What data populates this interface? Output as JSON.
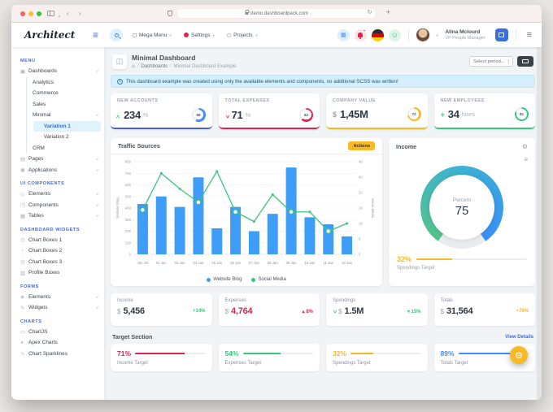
{
  "browser": {
    "url": "demo.dashboardpack.com",
    "new_tab": "+"
  },
  "header": {
    "logo": "Architect",
    "nav": [
      {
        "label": "Mega Menu"
      },
      {
        "label": "Settings"
      },
      {
        "label": "Projects"
      }
    ],
    "user": {
      "name": "Alina Mclourd",
      "role": "VP People Manager"
    }
  },
  "sidebar": {
    "sections": [
      {
        "header": "MENU",
        "items": [
          {
            "label": "Dashboards",
            "icon": "dashboards-icon",
            "chevron": true,
            "children": [
              {
                "label": "Analytics"
              },
              {
                "label": "Commerce"
              },
              {
                "label": "Sales"
              },
              {
                "label": "Minimal",
                "chevron": true,
                "children": [
                  {
                    "label": "Variation 1",
                    "active": true
                  },
                  {
                    "label": "Variation 2"
                  }
                ]
              },
              {
                "label": "CRM"
              }
            ]
          },
          {
            "label": "Pages",
            "icon": "pages-icon",
            "chevron": true
          },
          {
            "label": "Applications",
            "icon": "applications-icon",
            "chevron": true
          }
        ]
      },
      {
        "header": "UI COMPONENTS",
        "items": [
          {
            "label": "Elements",
            "icon": "elements-icon",
            "chevron": true
          },
          {
            "label": "Components",
            "icon": "components-icon",
            "chevron": true
          },
          {
            "label": "Tables",
            "icon": "tables-icon",
            "chevron": true
          }
        ]
      },
      {
        "header": "DASHBOARD WIDGETS",
        "items": [
          {
            "label": "Chart Boxes 1",
            "icon": "chart-box-1-icon"
          },
          {
            "label": "Chart Boxes 2",
            "icon": "chart-box-2-icon"
          },
          {
            "label": "Chart Boxes 3",
            "icon": "chart-box-3-icon"
          },
          {
            "label": "Profile Boxes",
            "icon": "profile-boxes-icon"
          }
        ]
      },
      {
        "header": "FORMS",
        "items": [
          {
            "label": "Elements",
            "icon": "form-elements-icon",
            "chevron": true
          },
          {
            "label": "Widgets",
            "icon": "widgets-icon",
            "chevron": true
          }
        ]
      },
      {
        "header": "CHARTS",
        "items": [
          {
            "label": "ChartJS",
            "icon": "chartjs-icon"
          },
          {
            "label": "Apex Charts",
            "icon": "apex-charts-icon"
          },
          {
            "label": "Chart Sparklines",
            "icon": "sparklines-icon"
          }
        ]
      }
    ],
    "icon_glyphs": {
      "dashboards-icon": "▣",
      "pages-icon": "▤",
      "applications-icon": "◉",
      "elements-icon": "◇",
      "components-icon": "◳",
      "tables-icon": "▦",
      "chart-box-1-icon": "◷",
      "chart-box-2-icon": "◔",
      "chart-box-3-icon": "◎",
      "profile-boxes-icon": "▥",
      "form-elements-icon": "◈",
      "widgets-icon": "✎",
      "chartjs-icon": "▭",
      "apex-charts-icon": "◕",
      "sparklines-icon": "∿"
    }
  },
  "page": {
    "title": "Minimal Dashboard",
    "breadcrumb": [
      "Dashboards",
      "Minimal Dashboard Example"
    ],
    "select_period": "Select period...",
    "alert": "This dashboard example was created using only the available elements and components, no additional SCSS was written!"
  },
  "kpis": [
    {
      "label": "NEW ACCOUNTS",
      "lead": {
        "kind": "chevron-up",
        "color": "#3ac47d"
      },
      "value": "234",
      "unit": "%",
      "gauge": {
        "value": 58,
        "color": "#3f8cfe"
      },
      "border_color": "#4a5ed5"
    },
    {
      "label": "TOTAL EXPENSES",
      "lead": {
        "kind": "chevron-down",
        "color": "#d92550"
      },
      "value": "71",
      "unit": "%",
      "gauge": {
        "value": 62,
        "color": "#d92550"
      },
      "border_color": "#d92550"
    },
    {
      "label": "COMPANY VALUE",
      "lead": {
        "kind": "text",
        "text": "$",
        "color": "#9aa3ad"
      },
      "value": "1,45M",
      "unit": "",
      "gauge": {
        "value": 72,
        "color": "#f7b924"
      },
      "border_color": "#f7b924"
    },
    {
      "label": "NEW EMPLOYEES",
      "lead": {
        "kind": "text",
        "text": "+",
        "color": "#3ac47d"
      },
      "value": "34",
      "unit": "hires",
      "gauge": {
        "value": 81,
        "color": "#3ac47d"
      },
      "border_color": "#3ac47d"
    }
  ],
  "traffic_card": {
    "title": "Traffic Sources",
    "action": "Actions"
  },
  "chart_data": [
    {
      "type": "bar+line",
      "title": "Traffic Sources",
      "categories": [
        "Jan '00",
        "02 Jan",
        "03 Jan",
        "04 Jan",
        "05 Jan",
        "06 Jan",
        "07 Jan",
        "08 Jan",
        "09 Jan",
        "10 Jan",
        "11 Jan",
        "12 Jan"
      ],
      "series": [
        {
          "name": "Website Blog",
          "type": "bar",
          "axis": "left",
          "color": "#3d9df7",
          "values": [
            435,
            500,
            410,
            665,
            225,
            410,
            200,
            350,
            750,
            320,
            260,
            155
          ]
        },
        {
          "name": "Social Media",
          "type": "line",
          "axis": "right",
          "color": "#3ac47d",
          "values": [
            23,
            42,
            34,
            27,
            43,
            22,
            17,
            31,
            22,
            22,
            12,
            16
          ],
          "ring_markers": [
            0,
            3,
            5,
            8,
            10
          ]
        }
      ],
      "left_axis": {
        "label": "Website Blog",
        "min": 0,
        "max": 800,
        "step": 100
      },
      "right_axis": {
        "label": "Social Media",
        "min": 0,
        "max": 48,
        "step": 8
      },
      "grid": true,
      "legend_position": "bottom"
    },
    {
      "type": "gauge",
      "title": "Income",
      "label": "Percent",
      "value": 75,
      "min": 0,
      "max": 100,
      "colors": [
        "#3ac47d",
        "#3a8ff7"
      ],
      "track_color": "#e8ecef"
    }
  ],
  "income_card": {
    "title": "Income",
    "percent_label": "Percent",
    "percent_value": "75",
    "target_pct": "32%",
    "target_pct_value": 32,
    "target_label": "Spendings Target",
    "target_color": "#f7b924"
  },
  "stats": [
    {
      "label": "Income",
      "currency": "$",
      "value": "5,456",
      "value_color": "#2f3944",
      "delta": {
        "text": "+14%",
        "color": "#3ac47d"
      }
    },
    {
      "label": "Expenses",
      "currency": "$",
      "value": "4,764",
      "value_color": "#d92550",
      "delta": {
        "dir": "up",
        "text": "8%",
        "color": "#d92550"
      }
    },
    {
      "label": "Spendings",
      "lead": {
        "kind": "chevron-down",
        "color": "#3ac47d"
      },
      "currency": "$",
      "value": "1.5M",
      "value_color": "#2f3944",
      "delta": {
        "dir": "down",
        "text": "15%",
        "color": "#3ac47d"
      }
    },
    {
      "label": "Totals",
      "currency": "$",
      "value": "31,564",
      "value_color": "#2f3944",
      "delta": {
        "text": "+76%",
        "color": "#f7b924"
      }
    }
  ],
  "targets_section": {
    "title": "Target Section",
    "link": "View Details",
    "cards": [
      {
        "pct": "71%",
        "value": 71,
        "label": "Income Target",
        "color": "#d92550"
      },
      {
        "pct": "54%",
        "value": 54,
        "label": "Expenses Target",
        "color": "#3ac47d"
      },
      {
        "pct": "32%",
        "value": 32,
        "label": "Spendings Target",
        "color": "#f7b924"
      },
      {
        "pct": "89%",
        "value": 89,
        "label": "Totals Target",
        "color": "#3f8cfe"
      }
    ]
  },
  "colors": {
    "primary": "#3f6ad8",
    "success": "#3ac47d",
    "danger": "#d92550",
    "warning": "#f7b924",
    "info_bright_blue": "#3f8cfe",
    "bar_blue": "#3d9df7",
    "alert_bg": "#d6effd",
    "main_bg": "#f1f4f6"
  }
}
